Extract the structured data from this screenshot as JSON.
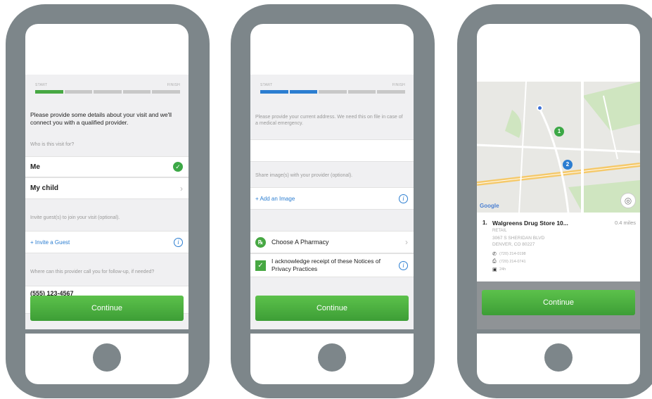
{
  "progress": {
    "start": "START",
    "finish": "FINISH"
  },
  "screen1": {
    "heading": "Please provide some details about your visit and we'll connect you with a qualified provider.",
    "question": "Who is this visit for?",
    "options": [
      {
        "label": "Me",
        "selected": true
      },
      {
        "label": "My child",
        "selected": false
      }
    ],
    "guest_prompt": "Invite guest(s) to join your visit (optional).",
    "invite_link": "+ Invite a Guest",
    "followup_prompt": "Where can this provider call you for follow-up, if needed?",
    "phone_value": "(555) 123-4567",
    "continue_label": "Continue"
  },
  "screen2": {
    "address_prompt": "Please provide your current address. We need this on file in case of a medical emergency.",
    "image_prompt": "Share image(s) with your provider (optional).",
    "add_image_link": "+ Add an Image",
    "pharmacy_label": "Choose A Pharmacy",
    "ack_label": "I acknowledge receipt of these Notices of Privacy Practices",
    "continue_label": "Continue"
  },
  "screen3": {
    "google_label": "Google",
    "result": {
      "index": "1.",
      "name": "Walgreens Drug Store 10...",
      "distance": "0.4 miles",
      "type": "RETAIL",
      "address_line1": "3067 S SHERIDAN BLVD",
      "address_line2": "DENVER, CO 80227",
      "phone": "(720) 214-0198",
      "fax": "(720) 214-0741",
      "hours": "24h"
    },
    "map_markers": [
      "1",
      "2"
    ],
    "continue_label": "Continue"
  },
  "colors": {
    "accent_green": "#47a843",
    "accent_blue": "#2c7ed1",
    "device_gray": "#7d868a"
  },
  "icons": [
    "check-icon",
    "chevron-right-icon",
    "info-icon",
    "pharmacy-icon",
    "checkbox-checked-icon",
    "phone-icon",
    "fax-icon",
    "hours-icon",
    "locate-icon",
    "map-pin-icon"
  ]
}
